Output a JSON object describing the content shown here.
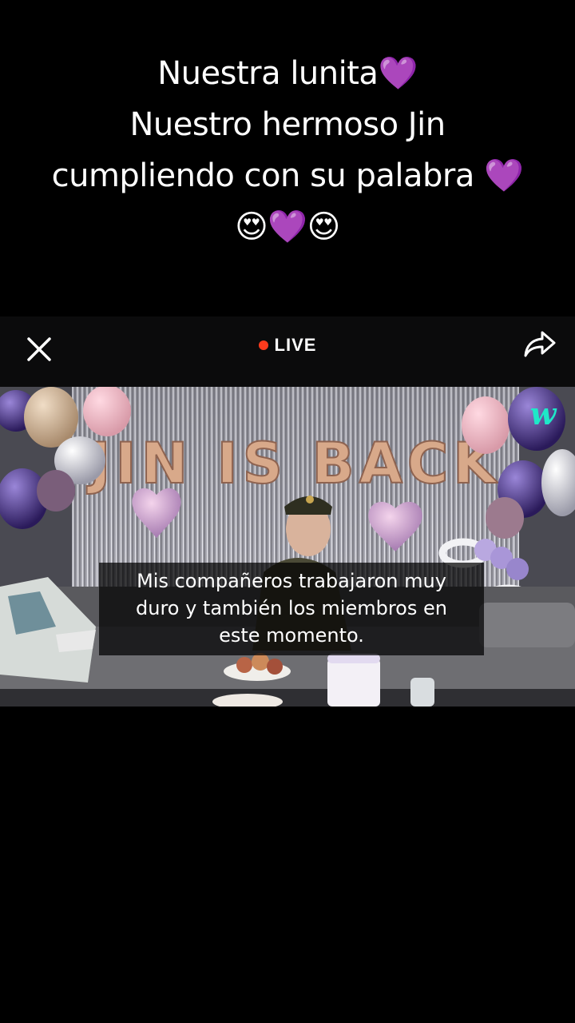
{
  "caption": {
    "line1": "Nuestra lunita💜",
    "line2": "Nuestro hermoso Jin",
    "line3": "cumpliendo con su palabra 💜",
    "line4": "😍💜😍"
  },
  "player": {
    "live_label": "LIVE",
    "close_icon": "close-icon",
    "share_icon": "share-icon",
    "live_dot_color": "#ff3b1d"
  },
  "video": {
    "banner_text": "JIN IS BACK",
    "subtitle": {
      "line1": "Mis compañeros trabajaron muy",
      "line2": "duro y también los miembros en",
      "line3": "este momento."
    },
    "watermark": "w",
    "accent_color": "#1ee8c8"
  }
}
